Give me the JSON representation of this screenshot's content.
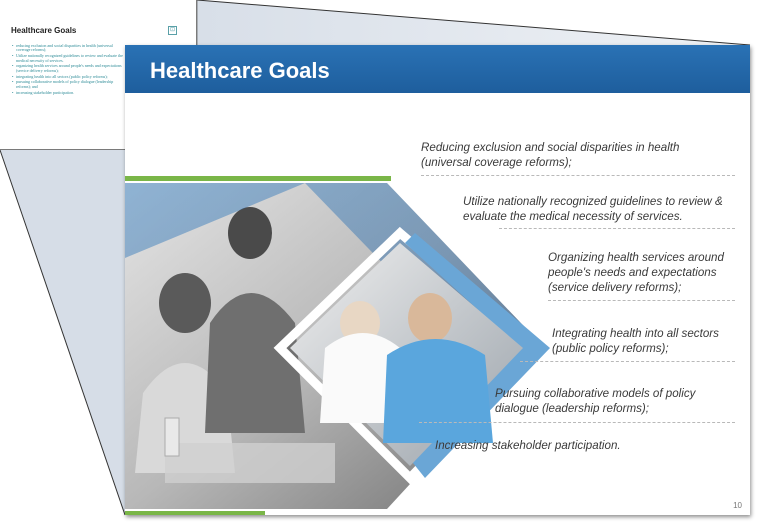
{
  "thumbnail": {
    "title": "Healthcare Goals",
    "icon": "image-placeholder-icon",
    "bullets": [
      "reducing exclusion and social disparities in health (universal coverage reforms);",
      "Utilize nationally recognized guidelines to review and evaluate the medical necessity of services.",
      "organizing health services around people's needs and expectations (service delivery reforms);",
      "integrating health into all sectors (public policy reforms);",
      "pursuing collaborative models of policy dialogue (leadership reforms); and",
      "increasing stakeholder participation."
    ]
  },
  "slide": {
    "title": "Healthcare Goals",
    "number": "10",
    "colors": {
      "header_blue": "#1f62a6",
      "accent_green": "#7ab648",
      "accent_light_blue": "#6aa6d6"
    },
    "goals": [
      {
        "line1": "Reducing exclusion and social disparities in health",
        "line2": "(universal coverage reforms);"
      },
      {
        "line1": "Utilize nationally recognized guidelines to review &",
        "line2": "evaluate the medical necessity of services."
      },
      {
        "line1": "Organizing health services around",
        "line2": "people's needs and expectations",
        "line3": "(service delivery reforms);"
      },
      {
        "line1": "Integrating health into all sectors",
        "line2": "(public policy reforms);"
      },
      {
        "line1": "Pursuing collaborative models of policy",
        "line2": "dialogue (leadership reforms);"
      },
      {
        "line1": "Increasing stakeholder participation."
      }
    ]
  }
}
